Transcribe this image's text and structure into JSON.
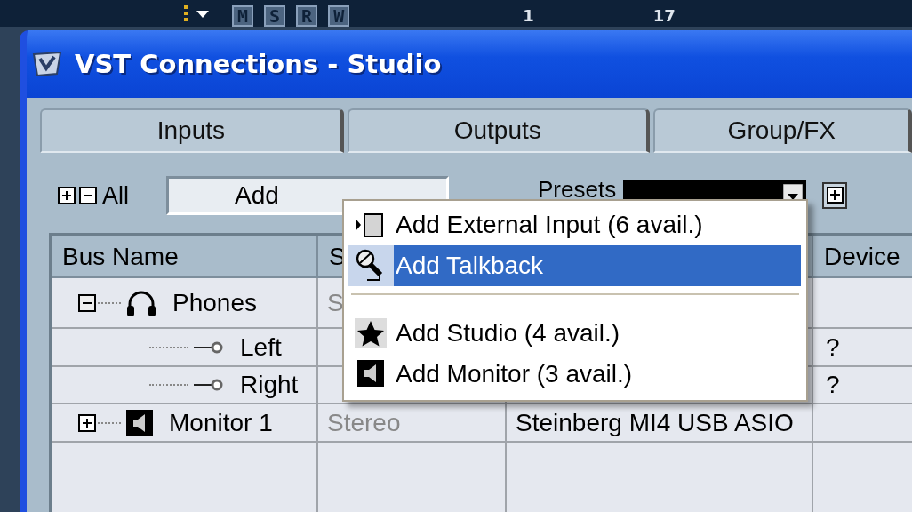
{
  "toolbar": {
    "buttons": [
      "M",
      "S",
      "R",
      "W"
    ],
    "ruler": [
      "1",
      "17"
    ]
  },
  "window": {
    "title": "VST Connections - Studio"
  },
  "tabs": [
    {
      "label": "Inputs",
      "selected": false
    },
    {
      "label": "Outputs",
      "selected": false
    },
    {
      "label": "Group/FX",
      "selected": false
    }
  ],
  "controls": {
    "expand_all": "All",
    "add_channel": "Add",
    "presets_label": "Presets"
  },
  "table": {
    "columns": [
      {
        "label": "Bus Name"
      },
      {
        "label": "S"
      },
      {},
      {
        "label": "Device"
      }
    ],
    "rows": [
      {
        "name": "Phones",
        "kind": "phones",
        "expanded": true,
        "speakers": "S",
        "port": null,
        "device": null,
        "children": [
          {
            "name": "Left",
            "kind": "channel",
            "device": "?"
          },
          {
            "name": "Right",
            "kind": "channel",
            "device": "?"
          }
        ]
      },
      {
        "name": "Monitor 1",
        "kind": "monitor",
        "expanded": false,
        "speakers": "Stereo",
        "port": "Steinberg MI4 USB ASIO",
        "device": null
      }
    ]
  },
  "menu": {
    "items": [
      {
        "kind": "submenu",
        "label": "Add External Input (6 avail.)",
        "selected": false
      },
      {
        "kind": "talkback",
        "label": "Add Talkback",
        "selected": true
      },
      {
        "kind": "separator"
      },
      {
        "kind": "studio",
        "label": "Add Studio (4 avail.)",
        "selected": false
      },
      {
        "kind": "monitor",
        "label": "Add Monitor (3 avail.)",
        "selected": false
      }
    ]
  }
}
